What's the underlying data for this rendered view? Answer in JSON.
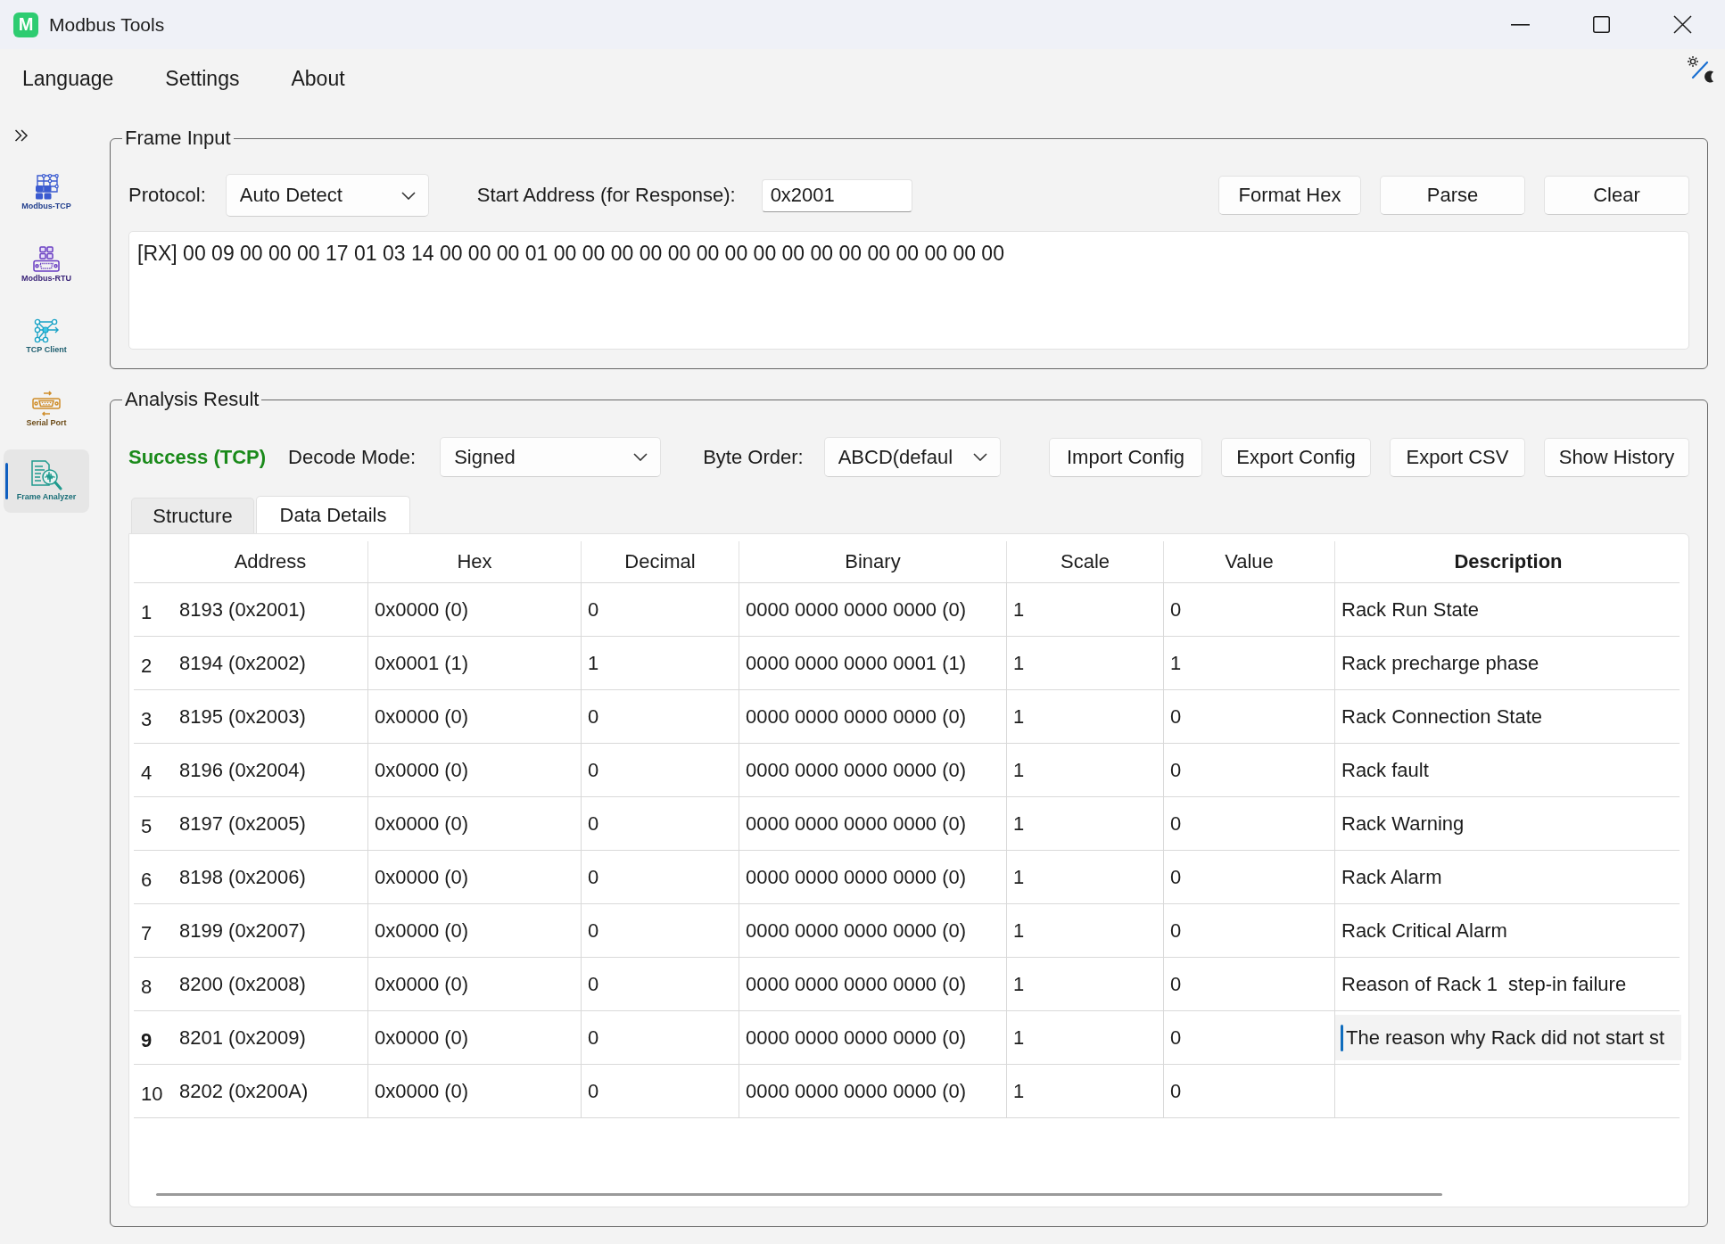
{
  "window": {
    "logo": "M",
    "title": "Modbus Tools"
  },
  "menu": [
    "Language",
    "Settings",
    "About"
  ],
  "sidebar": {
    "items": [
      {
        "label": "Modbus-TCP",
        "selected": false
      },
      {
        "label": "Modbus-RTU",
        "selected": false
      },
      {
        "label": "TCP Client",
        "selected": false
      },
      {
        "label": "Serial Port",
        "selected": false
      },
      {
        "label": "Frame Analyzer",
        "selected": true
      }
    ]
  },
  "frame_input": {
    "title": "Frame Input",
    "protocol_label": "Protocol:",
    "protocol": "Auto Detect",
    "start_address_label": "Start Address (for Response):",
    "start_address": "0x2001",
    "buttons": [
      "Format Hex",
      "Parse",
      "Clear"
    ],
    "frame": "[RX] 00 09 00 00 00 17 01 03 14 00 00 00 01 00 00 00 00 00 00 00 00 00 00 00 00 00 00 00 00"
  },
  "analysis": {
    "title": "Analysis Result",
    "status": {
      "text": "Success (TCP)",
      "kind": "success"
    },
    "decode_mode_label": "Decode Mode:",
    "decode_mode": "Signed",
    "byte_order_label": "Byte Order:",
    "byte_order": "ABCD(defaul",
    "buttons": [
      "Import Config",
      "Export Config",
      "Export CSV",
      "Show History"
    ],
    "tabs": [
      {
        "label": "Structure",
        "selected": false
      },
      {
        "label": "Data Details",
        "selected": true
      }
    ],
    "table": {
      "columns": [
        {
          "label": "Address",
          "selected": false
        },
        {
          "label": "Hex",
          "selected": false
        },
        {
          "label": "Decimal",
          "selected": false
        },
        {
          "label": "Binary",
          "selected": false
        },
        {
          "label": "Scale",
          "selected": false
        },
        {
          "label": "Value",
          "selected": false
        },
        {
          "label": "Description",
          "selected": true
        }
      ],
      "rows": [
        {
          "number": "1",
          "selected": false,
          "cells": [
            "8193 (0x2001)",
            "0x0000 (0)",
            "0",
            "0000 0000 0000 0000 (0)",
            "1",
            "0",
            "Rack Run State"
          ]
        },
        {
          "number": "2",
          "selected": false,
          "cells": [
            "8194 (0x2002)",
            "0x0001 (1)",
            "1",
            "0000 0000 0000 0001 (1)",
            "1",
            "1",
            "Rack precharge phase"
          ]
        },
        {
          "number": "3",
          "selected": false,
          "cells": [
            "8195 (0x2003)",
            "0x0000 (0)",
            "0",
            "0000 0000 0000 0000 (0)",
            "1",
            "0",
            "Rack Connection State"
          ]
        },
        {
          "number": "4",
          "selected": false,
          "cells": [
            "8196 (0x2004)",
            "0x0000 (0)",
            "0",
            "0000 0000 0000 0000 (0)",
            "1",
            "0",
            "Rack fault"
          ]
        },
        {
          "number": "5",
          "selected": false,
          "cells": [
            "8197 (0x2005)",
            "0x0000 (0)",
            "0",
            "0000 0000 0000 0000 (0)",
            "1",
            "0",
            "Rack Warning"
          ]
        },
        {
          "number": "6",
          "selected": false,
          "cells": [
            "8198 (0x2006)",
            "0x0000 (0)",
            "0",
            "0000 0000 0000 0000 (0)",
            "1",
            "0",
            "Rack Alarm"
          ]
        },
        {
          "number": "7",
          "selected": false,
          "cells": [
            "8199 (0x2007)",
            "0x0000 (0)",
            "0",
            "0000 0000 0000 0000 (0)",
            "1",
            "0",
            "Rack Critical Alarm"
          ]
        },
        {
          "number": "8",
          "selected": false,
          "cells": [
            "8200 (0x2008)",
            "0x0000 (0)",
            "0",
            "0000 0000 0000 0000 (0)",
            "1",
            "0",
            "Reason of Rack 1  step-in failure"
          ]
        },
        {
          "number": "9",
          "selected": true,
          "cells": [
            "8201 (0x2009)",
            "0x0000 (0)",
            "0",
            "0000 0000 0000 0000 (0)",
            "1",
            "0",
            "The reason why Rack did not start st"
          ]
        },
        {
          "number": "10",
          "selected": false,
          "cells": [
            "8202 (0x200A)",
            "0x0000 (0)",
            "0",
            "0000 0000 0000 0000 (0)",
            "1",
            "0"
          ]
        }
      ]
    }
  }
}
